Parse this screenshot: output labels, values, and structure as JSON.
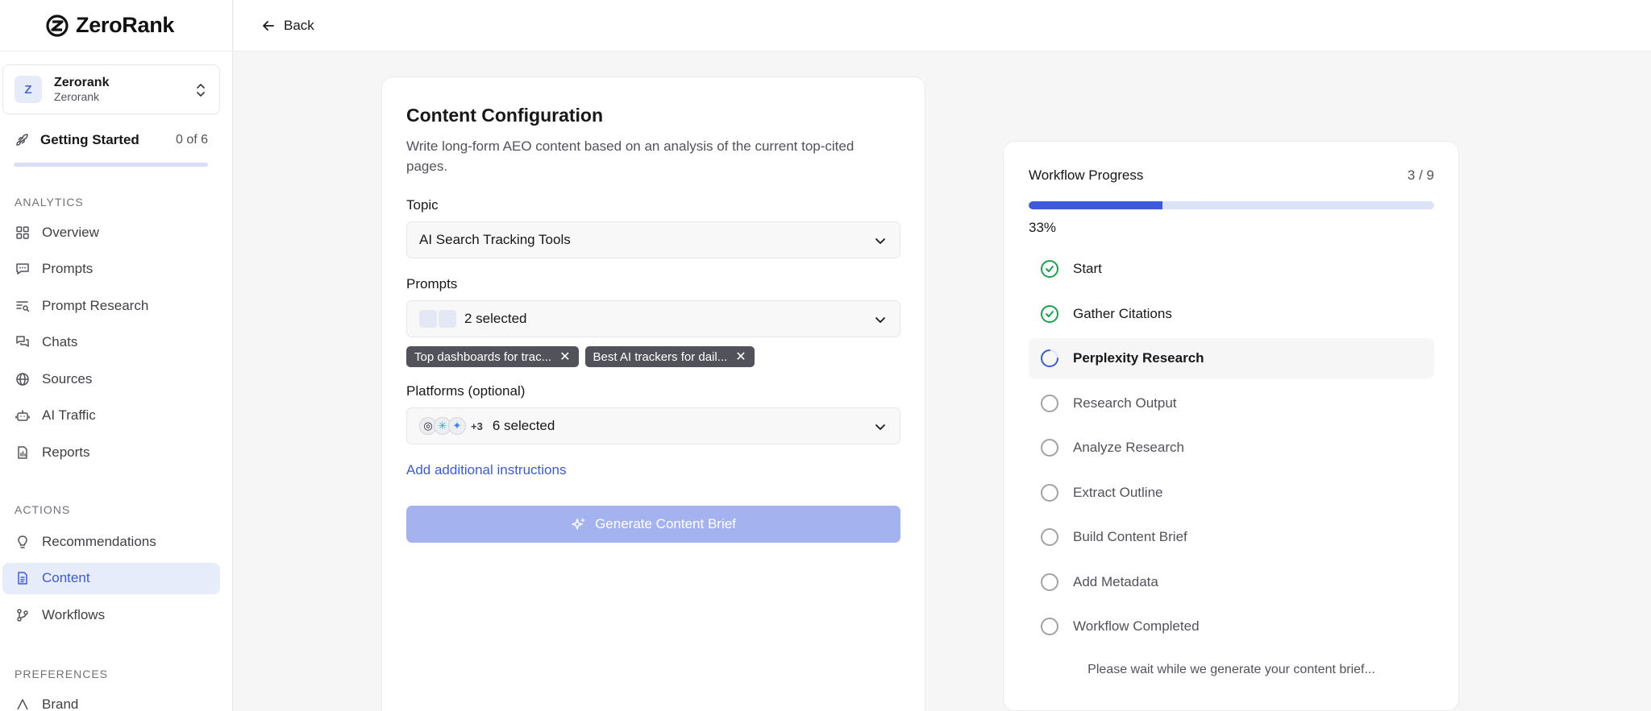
{
  "brand": {
    "name": "ZeroRank"
  },
  "workspace": {
    "avatar_letter": "Z",
    "name": "Zerorank",
    "sub": "Zerorank"
  },
  "getting_started": {
    "label": "Getting Started",
    "count": "0 of 6",
    "progress": 0
  },
  "nav": {
    "analytics_label": "ANALYTICS",
    "analytics": [
      {
        "label": "Overview",
        "icon": "grid-icon"
      },
      {
        "label": "Prompts",
        "icon": "message-icon"
      },
      {
        "label": "Prompt Research",
        "icon": "list-search-icon"
      },
      {
        "label": "Chats",
        "icon": "chats-icon"
      },
      {
        "label": "Sources",
        "icon": "globe-icon"
      },
      {
        "label": "AI Traffic",
        "icon": "bot-icon"
      },
      {
        "label": "Reports",
        "icon": "report-icon"
      }
    ],
    "actions_label": "ACTIONS",
    "actions": [
      {
        "label": "Recommendations",
        "icon": "lightbulb-icon"
      },
      {
        "label": "Content",
        "icon": "document-icon",
        "active": true
      },
      {
        "label": "Workflows",
        "icon": "workflow-icon"
      }
    ],
    "preferences_label": "PREFERENCES",
    "preferences": [
      {
        "label": "Brand",
        "icon": "brand-icon"
      }
    ]
  },
  "topbar": {
    "back_label": "Back"
  },
  "config": {
    "title": "Content Configuration",
    "description": "Write long-form AEO content based on an analysis of the current top-cited pages.",
    "topic_label": "Topic",
    "topic_value": "AI Search Tracking Tools",
    "prompts_label": "Prompts",
    "prompts_value": "2 selected",
    "prompt_chips": [
      "Top dashboards for trac...",
      "Best AI trackers for dail..."
    ],
    "platforms_label": "Platforms (optional)",
    "platforms_more": "+3",
    "platforms_value": "6 selected",
    "add_instructions": "Add additional instructions",
    "generate_label": "Generate Content Brief"
  },
  "progress": {
    "title": "Workflow Progress",
    "count": "3 / 9",
    "fraction": 0.33,
    "percent": "33%",
    "steps": [
      {
        "label": "Start",
        "status": "done"
      },
      {
        "label": "Gather Citations",
        "status": "done"
      },
      {
        "label": "Perplexity Research",
        "status": "current"
      },
      {
        "label": "Research Output",
        "status": "pending"
      },
      {
        "label": "Analyze Research",
        "status": "pending"
      },
      {
        "label": "Extract Outline",
        "status": "pending"
      },
      {
        "label": "Build Content Brief",
        "status": "pending"
      },
      {
        "label": "Add Metadata",
        "status": "pending"
      },
      {
        "label": "Workflow Completed",
        "status": "pending"
      }
    ],
    "wait_text": "Please wait while we generate your content brief..."
  },
  "colors": {
    "accent": "#3b5bdb",
    "success": "#16a34a",
    "disabled_button": "#a4b2ef"
  }
}
